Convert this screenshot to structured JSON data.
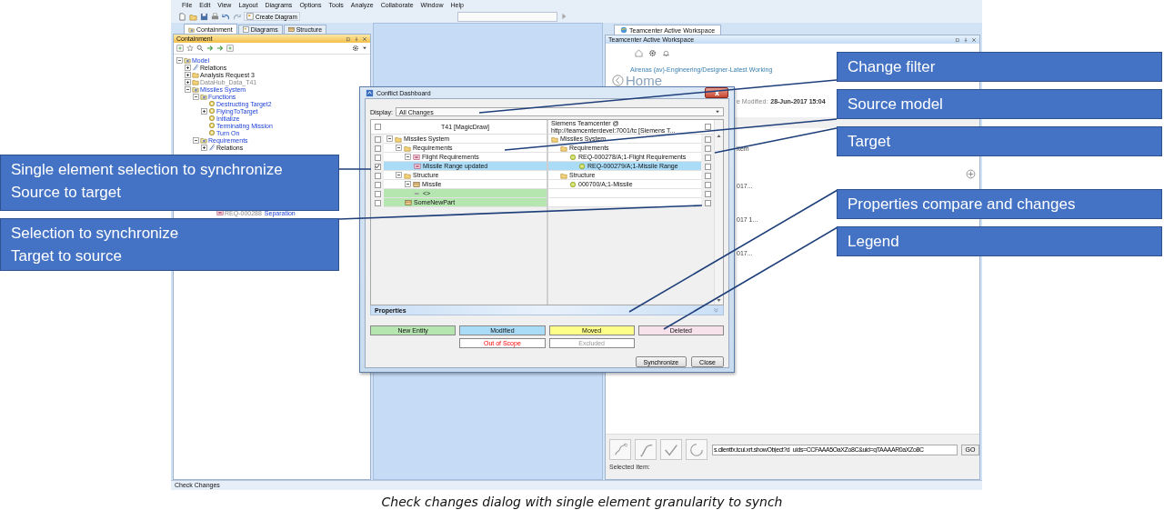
{
  "menu": [
    "File",
    "Edit",
    "View",
    "Layout",
    "Diagrams",
    "Options",
    "Tools",
    "Analyze",
    "Collaborate",
    "Window",
    "Help"
  ],
  "toolbar": {
    "create_diagram": "Create Diagram"
  },
  "containment": {
    "tabs": [
      {
        "label": "Containment",
        "selected": true
      },
      {
        "label": "Diagrams",
        "selected": false
      },
      {
        "label": "Structure",
        "selected": false
      }
    ],
    "title": "Containment",
    "tree": [
      {
        "label": "Model",
        "kind": "package",
        "link": true,
        "disabled": false,
        "expanded": true,
        "children": [
          {
            "label": "Relations",
            "kind": "relation",
            "link": false,
            "disabled": false,
            "expanded": false
          },
          {
            "label": "Analysis Request 3",
            "kind": "folder",
            "link": false,
            "disabled": false,
            "expanded": false
          },
          {
            "label": "DataHub_Data_T41",
            "kind": "folder",
            "disabled": true,
            "expanded": false
          },
          {
            "label": "Missiles System",
            "kind": "package",
            "link": true,
            "disabled": false,
            "expanded": true,
            "children": [
              {
                "label": "Functions",
                "kind": "package",
                "link": true,
                "disabled": false,
                "expanded": true,
                "children": [
                  {
                    "label": "Destructing Target2",
                    "kind": "activity",
                    "link": true,
                    "disabled": false
                  },
                  {
                    "label": "FlyingToTarget",
                    "kind": "activity",
                    "link": true,
                    "disabled": false,
                    "expanded": false
                  },
                  {
                    "label": "Initialize",
                    "kind": "activity",
                    "link": true,
                    "disabled": false
                  },
                  {
                    "label": "Terminating Mission",
                    "kind": "activity",
                    "link": true,
                    "disabled": false
                  },
                  {
                    "label": "Turn On",
                    "kind": "activity",
                    "link": true,
                    "disabled": false
                  }
                ]
              },
              {
                "label": "Requirements",
                "kind": "package",
                "link": true,
                "disabled": false,
                "expanded": true,
                "children": [
                  {
                    "label": "Relations",
                    "kind": "relation",
                    "link": false,
                    "disabled": false,
                    "expanded": false
                  }
                ]
              }
            ]
          }
        ]
      }
    ],
    "lower_item": {
      "id": "REQ-000288",
      "label": "Separation"
    }
  },
  "workspace": {
    "tab": "Teamcenter Active Workspace",
    "title": "Teamcenter Active Workspace",
    "breadcrumb": "Airenas (av)-Engineering/Designer-Latest Working",
    "heading": "Home",
    "modified_label": "e Modified:",
    "modified_value": "28-Jun-2017 15:04",
    "fragments": [
      "Item",
      "017...",
      "017 1...",
      "017..."
    ],
    "url": "s.clientfx.tcui.xrt.showObject?d_uids=CCFAAA5OaXZo8C&uid=gTAAAAR0aXZo8C",
    "go": "GO",
    "selected_label": "Selected Item:"
  },
  "status_bar": {
    "text": "Check Changes"
  },
  "dialog": {
    "title": "Conflict Dashboard",
    "display_label": "Display:",
    "display_value": "All Changes",
    "left_header": {
      "label": "T41 [MagicDraw]",
      "checked": false
    },
    "right_header": {
      "label": "Siemens Teamcenter @ http://teamcenterdevel:7001/tc [Siemens T...",
      "checked": false
    },
    "left_tree": [
      {
        "label": "Missiles System",
        "kind": "folder",
        "checked": false,
        "expanded": true,
        "children": [
          {
            "label": "Requirements",
            "kind": "folder",
            "checked": false,
            "expanded": true,
            "children": [
              {
                "label": "Flight Requirements",
                "kind": "requirement",
                "checked": false,
                "expanded": true,
                "children": [
                  {
                    "label": "Missile Range updated",
                    "kind": "requirement",
                    "checked": true,
                    "color": "#aadcf7"
                  }
                ]
              }
            ]
          },
          {
            "label": "Structure",
            "kind": "folder",
            "checked": false,
            "expanded": true,
            "children": [
              {
                "label": "Missile",
                "kind": "block",
                "checked": false,
                "expanded": true,
                "children": [
                  {
                    "label": "<>",
                    "kind": "port",
                    "checked": false,
                    "color": "#b5e6b0"
                  }
                ]
              },
              {
                "label": "SomeNewPart",
                "kind": "block",
                "checked": false,
                "color": "#b5e6b0"
              }
            ]
          }
        ]
      }
    ],
    "right_tree": [
      {
        "label": "Missiles System",
        "kind": "folder",
        "checked": false,
        "children": [
          {
            "label": "Requirements",
            "kind": "folder",
            "checked": false,
            "children": [
              {
                "label": "REQ-000278/A;1-Flight Requirements",
                "kind": "item",
                "checked": false,
                "children": [
                  {
                    "label": "REQ-000279/A;1-Missile Range",
                    "kind": "item",
                    "checked": false,
                    "color": "#aadcf7"
                  }
                ]
              }
            ]
          },
          {
            "label": "Structure",
            "kind": "folder",
            "checked": false,
            "children": [
              {
                "label": "000700/A;1-Missile",
                "kind": "item",
                "checked": false,
                "children": [
                  {
                    "checked": false
                  }
                ]
              },
              {
                "checked": false
              }
            ]
          }
        ]
      }
    ],
    "properties": "Properties",
    "legend": [
      {
        "label": "New Entity",
        "kind": "new"
      },
      {
        "label": "Modified",
        "kind": "modified"
      },
      {
        "label": "Moved",
        "kind": "moved"
      },
      {
        "label": "Deleted",
        "kind": "deleted"
      },
      {
        "label": "Out of Scope",
        "kind": "out_of_scope"
      },
      {
        "label": "Excluded",
        "kind": "excluded"
      }
    ],
    "buttons": [
      "Synchronize",
      "Close"
    ]
  },
  "callouts": [
    "Change filter",
    "Source model",
    "Target",
    "Single element selection to synchronize\nSource to target",
    "Properties compare and changes",
    "Selection to synchronize\nTarget to source",
    "Legend"
  ],
  "caption": "Check changes dialog with single element granularity to synch"
}
